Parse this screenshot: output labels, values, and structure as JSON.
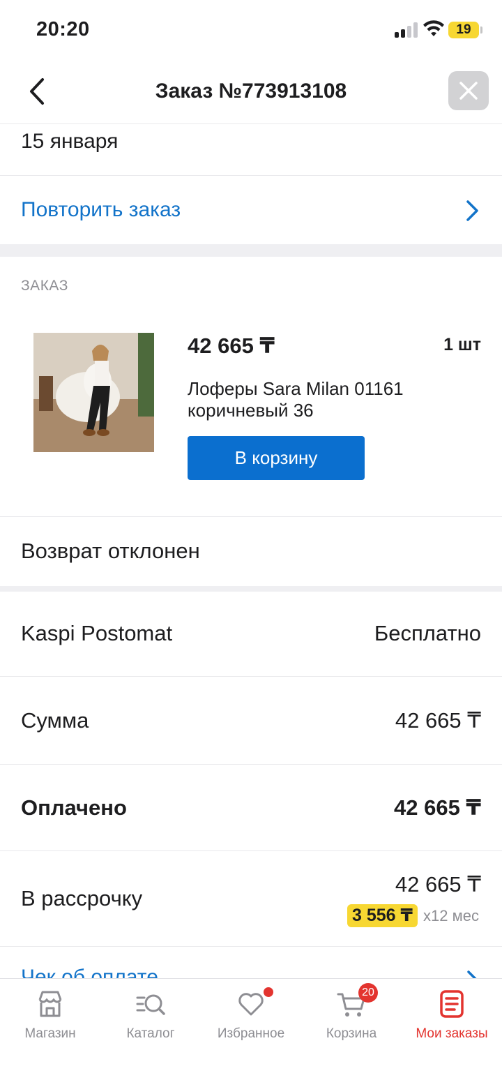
{
  "status_bar": {
    "time": "20:20",
    "battery": "19"
  },
  "header": {
    "title": "Заказ №773913108"
  },
  "order": {
    "date": "15 января",
    "repeat_label": "Повторить заказ",
    "section_label": "ЗАКАЗ",
    "item": {
      "price": "42 665 ₸",
      "quantity": "1 шт",
      "name": "Лоферы Sara Milan 01161 коричневый 36",
      "add_to_cart_label": "В корзину"
    },
    "return_status": "Возврат отклонен",
    "delivery": {
      "label": "Kaspi Postomat",
      "value": "Бесплатно"
    },
    "sum": {
      "label": "Сумма",
      "value": "42 665 ₸"
    },
    "paid": {
      "label": "Оплачено",
      "value": "42 665 ₸"
    },
    "installment": {
      "label": "В рассрочку",
      "value": "42 665 ₸",
      "monthly": "3 556 ₸",
      "term": "x12 мес"
    },
    "receipt_label": "Чек об оплате"
  },
  "tab_bar": {
    "items": [
      {
        "label": "Магазин",
        "icon": "store-icon"
      },
      {
        "label": "Каталог",
        "icon": "catalog-search-icon"
      },
      {
        "label": "Избранное",
        "icon": "heart-icon"
      },
      {
        "label": "Корзина",
        "icon": "cart-icon",
        "badge": "20"
      },
      {
        "label": "Мои заказы",
        "icon": "orders-icon"
      }
    ],
    "active_color": "#e3342f"
  },
  "colors": {
    "accent": "#1273c9",
    "button": "#0b6fcf",
    "highlight": "#f7d732"
  }
}
